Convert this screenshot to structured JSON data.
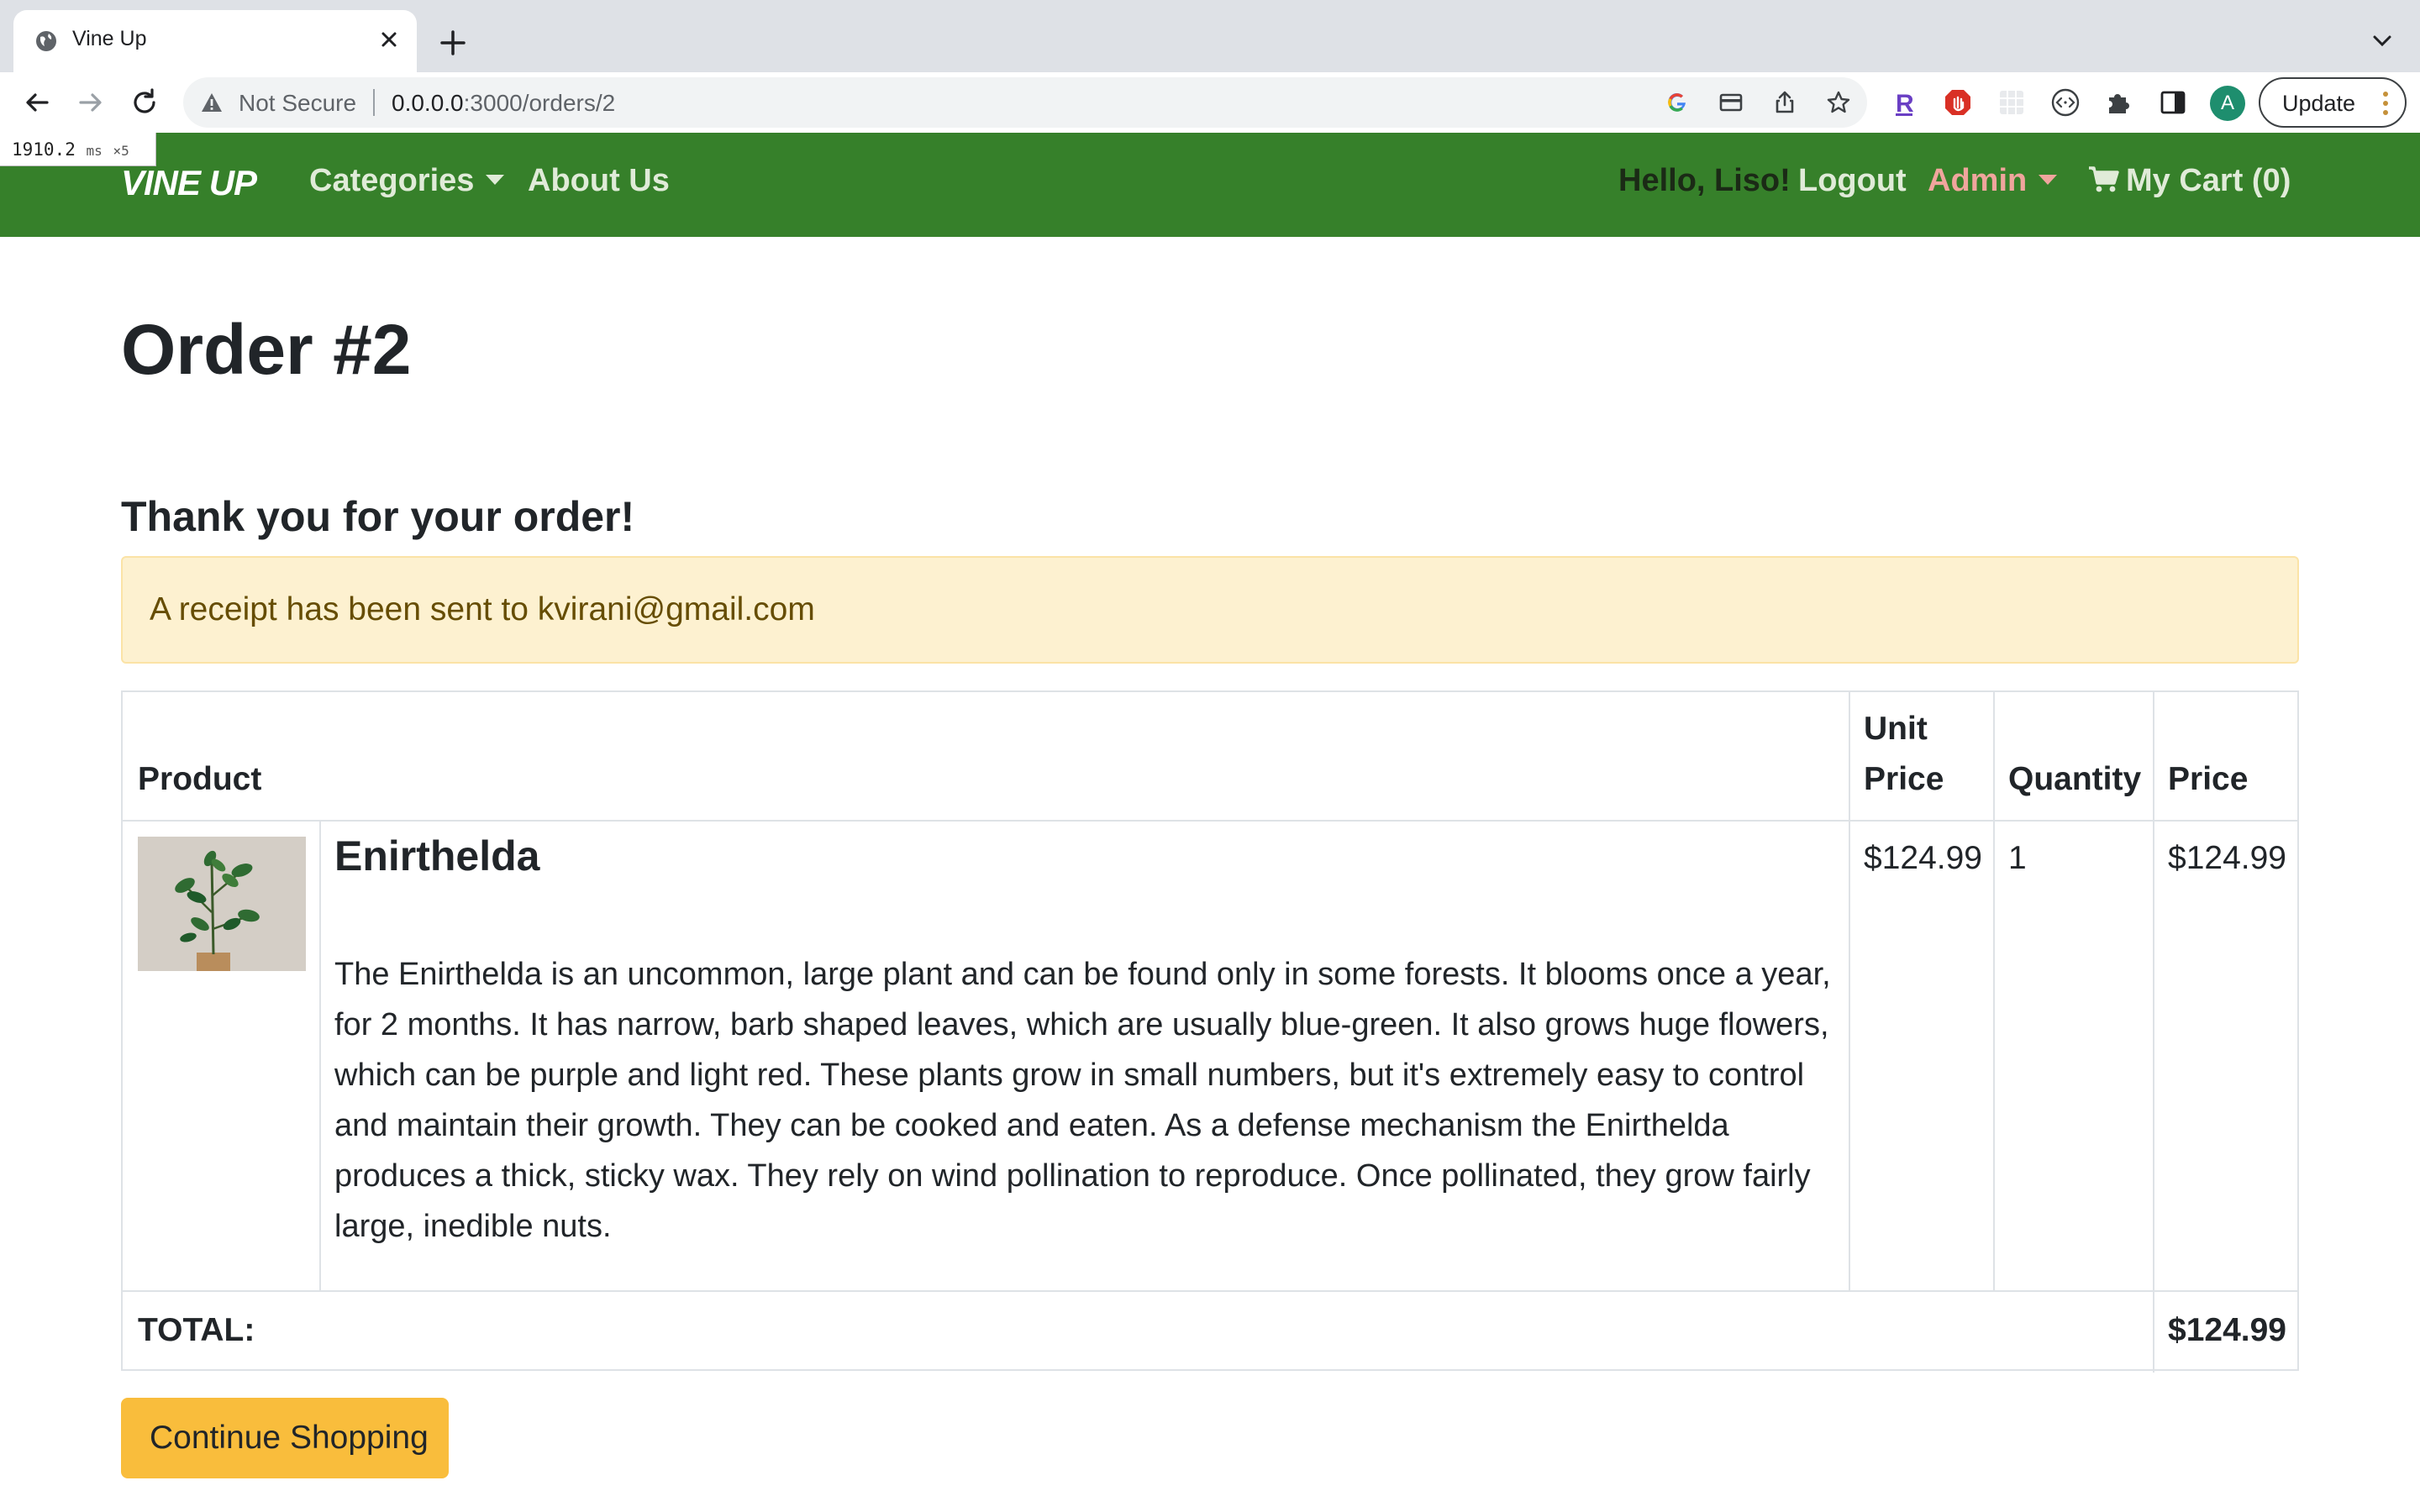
{
  "browser": {
    "tab_title": "Vine Up",
    "security_label": "Not Secure",
    "url_host": "0.0.0.0",
    "url_rest": ":3000/orders/2",
    "avatar_letter": "A",
    "update_label": "Update",
    "timing_value": "1910.2",
    "timing_unit": "ms",
    "timing_mult": "×5"
  },
  "nav": {
    "brand": "VINE UP",
    "categories": "Categories",
    "about": "About Us",
    "hello": "Hello, Liso!",
    "logout": "Logout",
    "admin": "Admin",
    "cart": "My Cart (0)"
  },
  "order": {
    "title": "Order #2",
    "thanks": "Thank you for your order!",
    "receipt_notice": "A receipt has been sent to kvirani@gmail.com",
    "columns": {
      "product": "Product",
      "unit_price_line1": "Unit",
      "unit_price_line2": "Price",
      "quantity": "Quantity",
      "price": "Price"
    },
    "items": [
      {
        "name": "Enirthelda",
        "description": "The Enirthelda is an uncommon, large plant and can be found only in some forests. It blooms once a year, for 2 months. It has narrow, barb shaped leaves, which are usually blue-green. It also grows huge flowers, which can be purple and light red. These plants grow in small numbers, but it's extremely easy to control and maintain their growth. They can be cooked and eaten. As a defense mechanism the Enirthelda produces a thick, sticky wax. They rely on wind pollination to reproduce. Once pollinated, they grow fairly large, inedible nuts.",
        "unit_price": "$124.99",
        "quantity": "1",
        "price": "$124.99"
      }
    ],
    "total_label": "TOTAL:",
    "total_value": "$124.99",
    "continue_label": "Continue Shopping"
  },
  "colors": {
    "navbar": "#36802a",
    "admin_accent": "#f0a59d",
    "alert_bg": "#fdf1d0",
    "button": "#f9bd3c"
  }
}
